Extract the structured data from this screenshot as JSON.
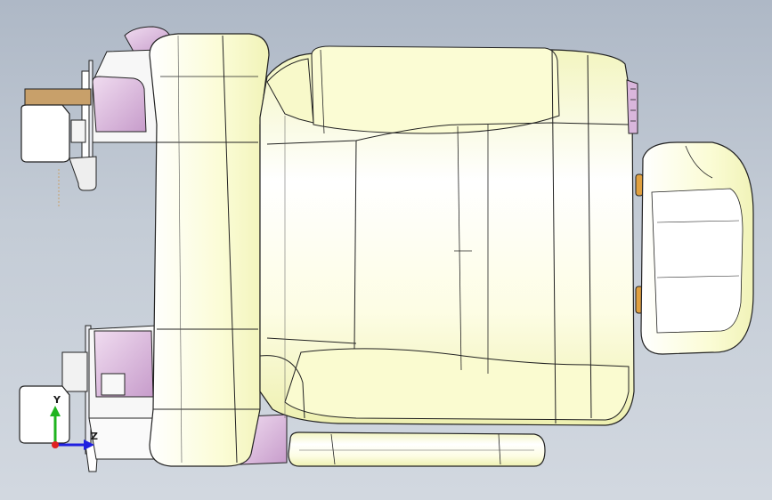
{
  "view": {
    "background_top": "#aeb8c6",
    "background_bottom": "#d2d8e0"
  },
  "colors": {
    "cushion_fill": "#fbfcd2",
    "cushion_highlight": "#ffffff",
    "trim_plastic": "#d9b6dc",
    "wood_bracket": "#c8a06a",
    "edge_line": "#1a1a1a",
    "orange_pad": "#e0a040",
    "axis_y": "#1fb41f",
    "axis_z": "#2020e0",
    "axis_origin": "#e02020"
  },
  "triad": {
    "y_label": "Y",
    "z_label": "Z",
    "origin_icon": "origin-dot-icon"
  }
}
